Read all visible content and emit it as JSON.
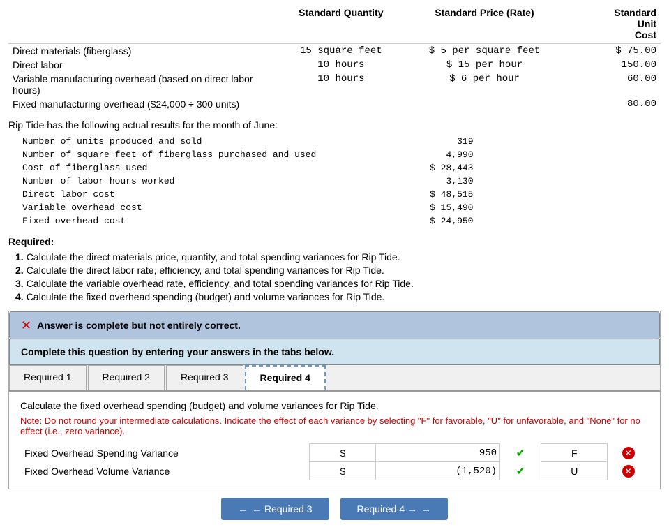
{
  "header": {
    "col1": "Standard Quantity",
    "col2": "Standard Price (Rate)",
    "col3": "Standard\nUnit\nCost"
  },
  "std_items": [
    {
      "label": "Direct materials (fiberglass)",
      "quantity": "15 square feet",
      "price": "$ 5 per square feet",
      "cost": "$ 75.00"
    },
    {
      "label": "Direct labor",
      "quantity": "10 hours",
      "price": "$ 15 per hour",
      "cost": "150.00"
    },
    {
      "label": "Variable manufacturing overhead (based on direct labor hours)",
      "quantity": "10 hours",
      "price": "$ 6 per hour",
      "cost": "60.00"
    },
    {
      "label": "Fixed manufacturing overhead ($24,000 ÷ 300 units)",
      "quantity": "",
      "price": "",
      "cost": "80.00"
    }
  ],
  "section_intro": "Rip Tide has the following actual results for the month of June:",
  "actual_items": [
    {
      "label": "Number of units produced and sold",
      "value": "319"
    },
    {
      "label": "Number of square feet of fiberglass purchased and used",
      "value": "4,990"
    },
    {
      "label": "Cost of fiberglass used",
      "value": "$ 28,443"
    },
    {
      "label": "Number of labor hours worked",
      "value": "3,130"
    },
    {
      "label": "Direct labor cost",
      "value": "$ 48,515"
    },
    {
      "label": "Variable overhead cost",
      "value": "$ 15,490"
    },
    {
      "label": "Fixed overhead cost",
      "value": "$ 24,950"
    }
  ],
  "required_heading": "Required:",
  "required_items": [
    {
      "num": "1.",
      "text": "Calculate the direct materials price, quantity, and total spending variances for Rip Tide."
    },
    {
      "num": "2.",
      "text": "Calculate the direct labor rate, efficiency, and total spending variances for Rip Tide."
    },
    {
      "num": "3.",
      "text": "Calculate the variable overhead rate, efficiency, and total spending variances for Rip Tide."
    },
    {
      "num": "4.",
      "text": "Calculate the fixed overhead spending (budget) and volume variances for Rip Tide."
    }
  ],
  "answer_banner": {
    "icon": "✕",
    "text": "Answer is complete but not entirely correct."
  },
  "complete_box": {
    "text": "Complete this question by entering your answers in the tabs below."
  },
  "tabs": [
    {
      "label": "Required 1"
    },
    {
      "label": "Required 2"
    },
    {
      "label": "Required 3"
    },
    {
      "label": "Required 4",
      "active": true
    }
  ],
  "tab4": {
    "description": "Calculate the fixed overhead spending (budget) and volume variances for Rip Tide.",
    "note": "Note: Do not round your intermediate calculations. Indicate the effect of each variance by selecting \"F\" for favorable, \"U\" for unfavorable, and \"None\" for no effect (i.e., zero variance).",
    "rows": [
      {
        "label": "Fixed Overhead Spending Variance",
        "dollar": "$",
        "value": "950",
        "value_style": "positive",
        "check": true,
        "letter": "F",
        "letter_correct": false
      },
      {
        "label": "Fixed Overhead Volume Variance",
        "dollar": "$",
        "value": "(1,520)",
        "value_style": "negative",
        "check": true,
        "letter": "U",
        "letter_correct": false
      }
    ]
  },
  "nav_buttons": {
    "prev_label": "← Required 3",
    "next_label": "Required 4 →"
  }
}
